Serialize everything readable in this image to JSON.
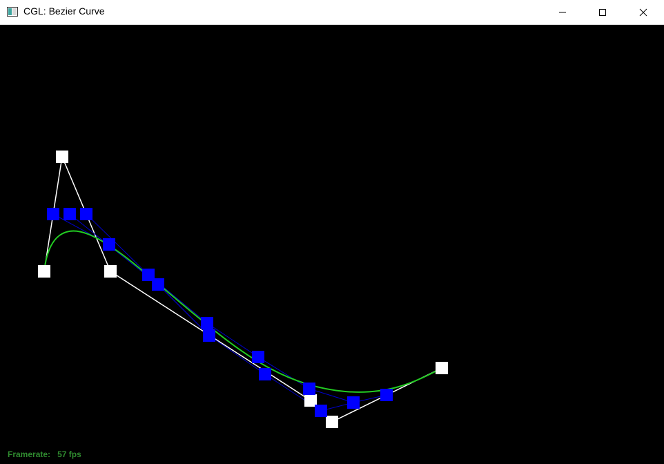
{
  "window": {
    "title": "CGL: Bezier Curve"
  },
  "status": {
    "framerate_label": "Framerate:",
    "framerate_value": "57 fps"
  },
  "colors": {
    "control_points": "#ffffff",
    "control_polygon": "#ffffff",
    "intermediate_points": "#0000ff",
    "intermediate_lines": "#0000cc",
    "curve": "#22cc22",
    "framerate_text": "#2f8a2f",
    "background": "#000000"
  },
  "icons": {
    "app": "app-window-icon",
    "minimize": "minimize-icon",
    "maximize": "maximize-icon",
    "close": "close-icon"
  }
}
